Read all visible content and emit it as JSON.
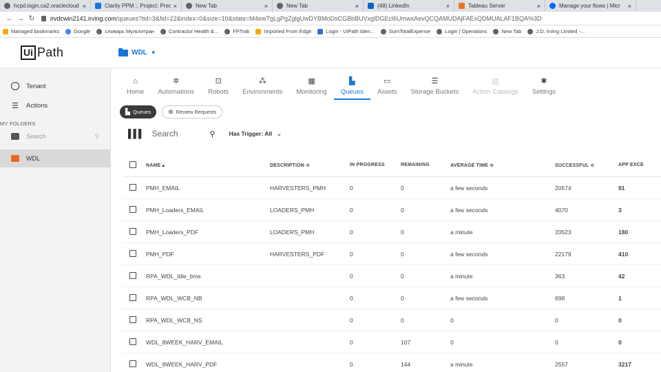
{
  "browser": {
    "tabs": [
      {
        "title": "hcpd.login.ca2.oraclecloud",
        "icon": "globe-icon",
        "active": false
      },
      {
        "title": "Clarity PPM :: Project: Prec",
        "icon": "clarity-icon",
        "active": false
      },
      {
        "title": "New Tab",
        "icon": "globe-icon",
        "active": false
      },
      {
        "title": "New Tab",
        "icon": "globe-icon",
        "active": false
      },
      {
        "title": "(48) LinkedIn",
        "icon": "linkedin-icon",
        "active": false
      },
      {
        "title": "Tableau Server",
        "icon": "tableau-icon",
        "active": false
      },
      {
        "title": "Manage your flows | Micr",
        "icon": "flow-icon",
        "active": false
      }
    ],
    "url_host": "irvdcwin2141.irving.com",
    "url_path": "/queues?tid=3&fid=22&index=0&size=10&state=M4ewTgLgPgZglgUwDYBMoDsCGBbBUVxglDGEcl6UmwxAevQCQAMUDAjFAExQDMUALAF1BQA%3D",
    "bookmarks": [
      {
        "label": "Managed bookmarks",
        "icon": "folder-icon"
      },
      {
        "label": "Google",
        "icon": "google-icon"
      },
      {
        "label": "словарь Мультитран",
        "icon": "globe-icon"
      },
      {
        "label": "Contractor Health &...",
        "icon": "globe-icon"
      },
      {
        "label": "FPTrak",
        "icon": "globe-icon"
      },
      {
        "label": "Imported From Edge",
        "icon": "folder-icon"
      },
      {
        "label": "Login - UiPath Iden...",
        "icon": "uipath-icon"
      },
      {
        "label": "SumTotalExpense",
        "icon": "globe-icon"
      },
      {
        "label": "Login | Operations",
        "icon": "globe-icon"
      },
      {
        "label": "New Tab",
        "icon": "globe-icon"
      },
      {
        "label": "J.D. Irving Limited -...",
        "icon": "globe-icon"
      }
    ]
  },
  "header": {
    "logo_box": "Ui",
    "logo_text": "Path",
    "folder": "WDL"
  },
  "sidebar": {
    "tenant": "Tenant",
    "actions": "Actions",
    "section": "MY FOLDERS",
    "search_placeholder": "Search",
    "folder": "WDL"
  },
  "nav": {
    "tabs": [
      {
        "label": "Home",
        "icon": "home-icon",
        "glyph": "⌂",
        "state": "normal"
      },
      {
        "label": "Automations",
        "icon": "automations-icon",
        "glyph": "✲",
        "state": "normal"
      },
      {
        "label": "Robots",
        "icon": "robot-icon",
        "glyph": "⊡",
        "state": "normal"
      },
      {
        "label": "Environments",
        "icon": "environments-icon",
        "glyph": "⁂",
        "state": "normal"
      },
      {
        "label": "Monitoring",
        "icon": "monitoring-icon",
        "glyph": "▦",
        "state": "normal"
      },
      {
        "label": "Queues",
        "icon": "queues-icon",
        "glyph": "▙",
        "state": "active"
      },
      {
        "label": "Assets",
        "icon": "assets-icon",
        "glyph": "▭",
        "state": "normal"
      },
      {
        "label": "Storage Buckets",
        "icon": "storage-icon",
        "glyph": "☰",
        "state": "normal"
      },
      {
        "label": "Action Catalogs",
        "icon": "catalog-icon",
        "glyph": "▥",
        "state": "disabled"
      },
      {
        "label": "Settings",
        "icon": "gear-icon",
        "glyph": "✱",
        "state": "normal"
      }
    ]
  },
  "subnav": {
    "queues": "Queues",
    "review": "Review Requests"
  },
  "toolbar": {
    "search_placeholder": "Search",
    "trigger": "Has Trigger: All"
  },
  "table": {
    "columns": [
      "NAME ▴",
      "DESCRIPTION ≎",
      "IN PROGRESS",
      "REMAINING",
      "AVERAGE TIME ≎",
      "SUCCESSFUL ≎",
      "APP EXCE"
    ],
    "rows": [
      {
        "name": "PMH_EMAIL",
        "description": "HARVESTERS_PMH",
        "in_progress": "0",
        "remaining": "0",
        "avg": "a few seconds",
        "successful": "20574",
        "exceptions": "91"
      },
      {
        "name": "PMH_Loaders_EMAIL",
        "description": "LOADERS_PMH",
        "in_progress": "0",
        "remaining": "0",
        "avg": "a few seconds",
        "successful": "4070",
        "exceptions": "3"
      },
      {
        "name": "PMH_Loaders_PDF",
        "description": "LOADERS_PMH",
        "in_progress": "0",
        "remaining": "0",
        "avg": "a minute",
        "successful": "20523",
        "exceptions": "180"
      },
      {
        "name": "PMH_PDF",
        "description": "HARVESTERS_PDF",
        "in_progress": "0",
        "remaining": "0",
        "avg": "a few seconds",
        "successful": "22179",
        "exceptions": "410"
      },
      {
        "name": "RPA_WDL_Idle_time",
        "description": "",
        "in_progress": "0",
        "remaining": "0",
        "avg": "a minute",
        "successful": "363",
        "exceptions": "42"
      },
      {
        "name": "RPA_WDL_WCB_NB",
        "description": "",
        "in_progress": "0",
        "remaining": "0",
        "avg": "a few seconds",
        "successful": "698",
        "exceptions": "1"
      },
      {
        "name": "RPA_WDL_WCB_NS",
        "description": "",
        "in_progress": "0",
        "remaining": "0",
        "avg": "0",
        "successful": "0",
        "exceptions": "0"
      },
      {
        "name": "WDL_8WEEK_HARV_EMAIL",
        "description": "",
        "in_progress": "0",
        "remaining": "107",
        "avg": "0",
        "successful": "0",
        "exceptions": "0"
      },
      {
        "name": "WDL_8WEEK_HARV_PDF",
        "description": "",
        "in_progress": "0",
        "remaining": "144",
        "avg": "a minute",
        "successful": "2557",
        "exceptions": "3217"
      }
    ]
  },
  "colors": {
    "accent": "#1976d2",
    "sidebar_bg": "#f3f3f3",
    "folder_orange": "#f26422"
  }
}
